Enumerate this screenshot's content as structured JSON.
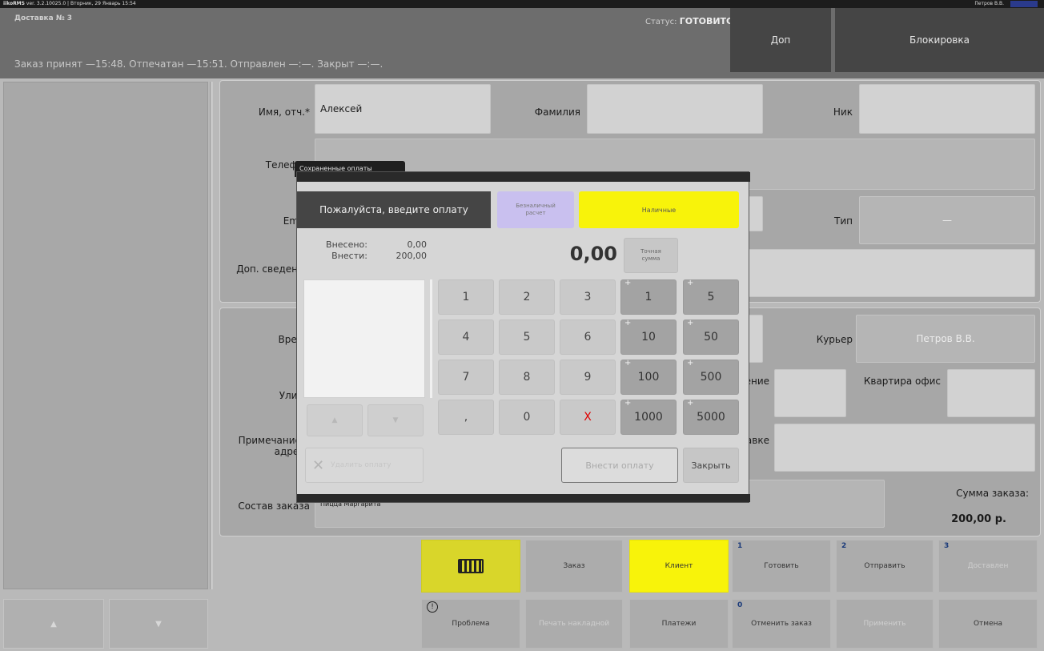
{
  "topbar": {
    "app": "iikoRMS",
    "version": "ver. 3.2.10025.0",
    "date": "Вторник, 29 Январь 15:54",
    "user": "Петров В.В."
  },
  "header": {
    "title": "Доставка № 3",
    "timeline": "Заказ принят —15:48. Отпечатан —15:51. Отправлен —:—. Закрыт —:—.",
    "status_label": "Статус:",
    "status_value": "ГОТОВИТСЯ",
    "btn_dop": "Доп",
    "btn_block": "Блокировка"
  },
  "client": {
    "name_label": "Имя, отч.*",
    "name_value": "Алексей",
    "surname_label": "Фамилия",
    "surname_value": "",
    "nick_label": "Ник",
    "nick_value": "",
    "phone_label": "Телефон",
    "email_label": "Email",
    "type_label": "Тип",
    "type_value": "—",
    "extra_label": "Доп. сведения"
  },
  "address": {
    "time_label": "Время",
    "courier_label": "Курьер",
    "courier_value": "Петров В.В.",
    "street_label": "Улица",
    "corpus_label": "Корпус строение",
    "flat_label": "Квартира офис",
    "note_label": "Примечание к адресу",
    "info_label": "Инфо о доставке",
    "order_label": "Состав заказа",
    "order_value": "Пицца Маргарита",
    "sum_label": "Сумма заказа:",
    "sum_value": "200,00 р."
  },
  "dialog": {
    "title": "Сохраненные оплаты",
    "prompt": "Пожалуйста, введите оплату",
    "cashless": "Безналичный расчет",
    "cash": "Наличные",
    "paid_label": "Внесено:",
    "paid_value": "0,00",
    "due_label": "Внести:",
    "due_value": "200,00",
    "amount": "0,00",
    "exact_sum": "Точная сумма",
    "keys": [
      "1",
      "2",
      "3",
      "4",
      "5",
      "6",
      "7",
      "8",
      "9",
      ",",
      "0",
      "X"
    ],
    "quick": [
      "1",
      "5",
      "10",
      "50",
      "100",
      "500",
      "1000",
      "5000"
    ],
    "delete_payment": "Удалить оплату",
    "submit_payment": "Внести оплату",
    "close": "Закрыть"
  },
  "bottom": {
    "row1": [
      {
        "label": "",
        "num": ""
      },
      {
        "label": "Заказ",
        "num": ""
      },
      {
        "label": "Клиент",
        "num": ""
      },
      {
        "label": "Готовить",
        "num": "1"
      },
      {
        "label": "Отправить",
        "num": "2"
      },
      {
        "label": "Доставлен",
        "num": "3"
      }
    ],
    "row2": [
      {
        "label": "Проблема",
        "num": ""
      },
      {
        "label": "Печать накладной",
        "num": ""
      },
      {
        "label": "Платежи",
        "num": ""
      },
      {
        "label": "Отменить заказ",
        "num": "0"
      },
      {
        "label": "Применить",
        "num": ""
      },
      {
        "label": "Отмена",
        "num": ""
      }
    ]
  },
  "colors": {
    "yellow": "#f8f30a",
    "keyboard_yellow": "#d9d62a",
    "lavender": "#c9c0ef",
    "dark": "#454545"
  }
}
